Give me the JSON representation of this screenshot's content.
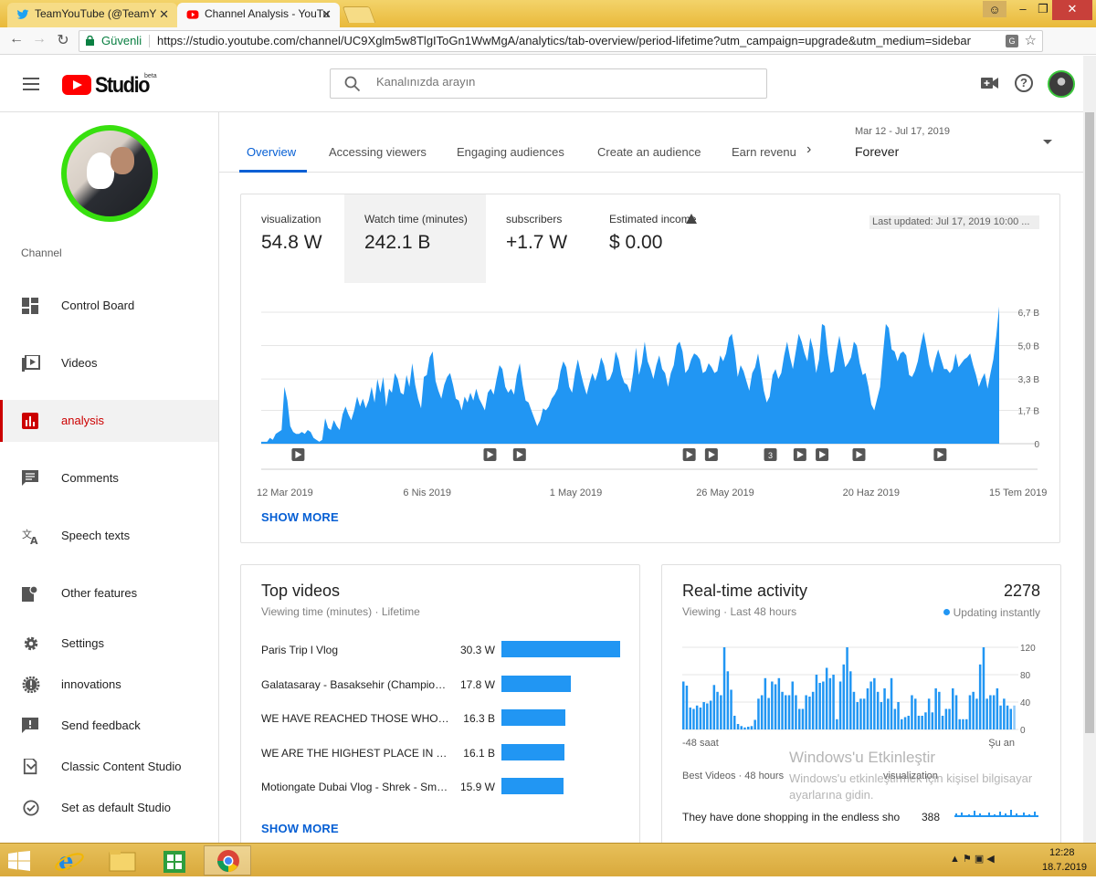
{
  "browser": {
    "tabs": [
      {
        "title": "TeamYouTube (@TeamY",
        "favicon": "twitter-icon"
      },
      {
        "title": "Channel Analysis - YouTu",
        "favicon": "youtube-icon"
      }
    ],
    "close_glyph": "✕",
    "secure_label": "Güvenli",
    "url": "https://studio.youtube.com/channel/UC9Xglm5w8TlgIToGn1WwMgA/analytics/tab-overview/period-lifetime?utm_campaign=upgrade&utm_medium=sidebar",
    "colors": {
      "tabbar": "#f3d36a",
      "close": "#c8403a"
    }
  },
  "header": {
    "logo_text": "Studio",
    "logo_badge": "beta",
    "search_placeholder": "Kanalınızda arayın",
    "brand_color": "#ff0000"
  },
  "sidebar": {
    "channel_label": "Channel",
    "items": [
      {
        "label": "Control Board",
        "icon": "dashboard-icon",
        "active": false
      },
      {
        "label": "Videos",
        "icon": "video-library-icon",
        "active": false
      },
      {
        "label": "analysis",
        "icon": "analytics-icon",
        "active": true
      },
      {
        "label": "Comments",
        "icon": "comment-icon",
        "active": false
      },
      {
        "label": "Speech texts",
        "icon": "translate-icon",
        "active": false
      },
      {
        "label": "Other features",
        "icon": "more-features-icon",
        "active": false
      },
      {
        "label": "Settings",
        "icon": "gear-icon",
        "active": false
      },
      {
        "label": "innovations",
        "icon": "alert-badge-icon",
        "active": false
      },
      {
        "label": "Send feedback",
        "icon": "feedback-icon",
        "active": false
      },
      {
        "label": "Classic Content Studio",
        "icon": "classic-studio-icon",
        "active": false
      },
      {
        "label": "Set as default Studio",
        "icon": "check-circle-icon",
        "active": false
      }
    ],
    "active_color": "#cc0000"
  },
  "analytics": {
    "tabs": [
      "Overview",
      "Accessing viewers",
      "Engaging audiences",
      "Create an audience",
      "Earn revenu"
    ],
    "period_dates": "Mar 12 - Jul 17, 2019",
    "period_value": "Forever",
    "metrics": [
      {
        "label": "visualization",
        "value": "54.8 W"
      },
      {
        "label": "Watch time (minutes)",
        "value": "242.1 B",
        "selected": true
      },
      {
        "label": "subscribers",
        "value": "+1.7 W"
      },
      {
        "label": "Estimated income",
        "value": "$ 0.00",
        "warning": true
      }
    ],
    "last_updated": "Last updated: Jul 17, 2019 10:00 ...",
    "show_more": "SHOW MORE",
    "accent": "#065fd4"
  },
  "chart_data": [
    {
      "type": "area",
      "title": "",
      "ylabel": "",
      "y_ticks": [
        "0",
        "1,7 B",
        "3,3 B",
        "5,0 B",
        "6,7 B"
      ],
      "y_tick_values": [
        0,
        1.7,
        3.3,
        5.0,
        6.7
      ],
      "ylim": [
        0,
        6.7
      ],
      "x_ticks": [
        "12 Mar 2019",
        "6 Nis 2019",
        "1 May 2019",
        "26 May 2019",
        "20 Haz 2019",
        "15 Tem 2019"
      ],
      "series": [
        {
          "values": [
            0.1,
            0.1,
            0.1,
            0.3,
            0.2,
            0.5,
            0.6,
            0.7,
            2.9,
            2.2,
            0.9,
            0.6,
            0.5,
            0.5,
            0.6,
            0.5,
            0.7,
            0.6,
            0.3,
            0.2,
            0.1,
            0.2,
            1.3,
            0.8,
            0.7,
            1.2,
            0.9,
            0.7,
            1.5,
            1.9,
            1.5,
            1.2,
            1.7,
            2.4,
            1.9,
            2.3,
            1.8,
            2.2,
            2.9,
            2.1,
            3.3,
            2.6,
            3.4,
            1.9,
            2.8,
            2.6,
            3.6,
            3.3,
            2.6,
            2.5,
            3.5,
            2.9,
            4.1,
            3.0,
            2.3,
            1.8,
            3.4,
            3.5,
            4.4,
            4.7,
            3.2,
            2.7,
            2.3,
            3.0,
            3.4,
            3.6,
            3.0,
            2.3,
            2.2,
            1.7,
            2.4,
            2.1,
            2.6,
            2.2,
            2.8,
            2.3,
            2.0,
            1.7,
            2.6,
            2.8,
            2.5,
            3.3,
            4.0,
            3.8,
            2.9,
            2.6,
            2.8,
            2.5,
            3.5,
            4.1,
            3.0,
            2.2,
            2.1,
            1.7,
            1.3,
            0.9,
            1.2,
            1.8,
            1.7,
            1.9,
            2.3,
            2.5,
            2.8,
            3.7,
            4.2,
            3.9,
            2.9,
            2.6,
            3.6,
            4.3,
            3.6,
            3.0,
            2.5,
            3.1,
            3.6,
            3.2,
            3.7,
            4.4,
            4.0,
            3.2,
            3.3,
            3.7,
            4.7,
            4.3,
            3.5,
            3.1,
            3.0,
            2.6,
            3.6,
            4.9,
            3.5,
            4.1,
            5.2,
            4.2,
            3.8,
            3.3,
            4.0,
            4.5,
            3.8,
            3.6,
            2.9,
            3.6,
            4.0,
            5.0,
            5.2,
            4.7,
            3.6,
            3.8,
            4.3,
            4.6,
            4.5,
            4.3,
            3.6,
            3.7,
            4.1,
            3.9,
            3.6,
            3.7,
            4.5,
            4.2,
            4.6,
            5.4,
            5.6,
            4.7,
            3.4,
            4.0,
            3.7,
            3.2,
            2.7,
            3.6,
            3.9,
            4.6,
            3.7,
            2.7,
            2.1,
            2.4,
            3.5,
            3.8,
            3.3,
            3.6,
            4.5,
            5.2,
            4.4,
            3.8,
            4.7,
            5.6,
            5.2,
            4.6,
            4.2,
            5.4,
            4.8,
            3.6,
            4.3,
            6.1,
            6.0,
            4.6,
            3.6,
            3.7,
            4.7,
            5.5,
            4.7,
            3.9,
            4.1,
            4.4,
            5.2,
            5.0,
            4.1,
            3.5,
            3.6,
            2.9,
            2.0,
            1.7,
            2.3,
            2.9,
            4.6,
            6.1,
            5.9,
            4.8,
            4.7,
            4.2,
            4.6,
            4.7,
            4.5,
            3.5,
            3.4,
            3.7,
            4.2,
            5.0,
            5.7,
            4.9,
            4.0,
            3.6,
            4.3,
            4.8,
            4.3,
            3.8,
            3.8,
            3.6,
            3.8,
            4.6,
            3.9,
            4.1,
            4.3,
            4.4,
            4.6,
            4.0,
            3.5,
            2.9,
            3.3,
            3.6,
            2.8,
            3.6,
            4.3,
            5.5,
            7.0
          ]
        }
      ],
      "markers": [
        {
          "x_frac": 0.05,
          "label": ""
        },
        {
          "x_frac": 0.31,
          "label": ""
        },
        {
          "x_frac": 0.35,
          "label": ""
        },
        {
          "x_frac": 0.58,
          "label": ""
        },
        {
          "x_frac": 0.61,
          "label": ""
        },
        {
          "x_frac": 0.69,
          "label": "3"
        },
        {
          "x_frac": 0.73,
          "label": ""
        },
        {
          "x_frac": 0.76,
          "label": ""
        },
        {
          "x_frac": 0.81,
          "label": ""
        },
        {
          "x_frac": 0.92,
          "label": ""
        }
      ],
      "color": "#2196f3"
    },
    {
      "type": "bar",
      "title": "",
      "ylabel": "",
      "y_ticks": [
        "0",
        "40",
        "80",
        "120"
      ],
      "y_tick_values": [
        0,
        40,
        80,
        120
      ],
      "ylim": [
        0,
        120
      ],
      "x_ticks": [
        "-48 saat",
        "Şu an"
      ],
      "values": [
        70,
        64,
        32,
        30,
        35,
        32,
        40,
        38,
        42,
        65,
        55,
        50,
        120,
        85,
        58,
        20,
        8,
        5,
        3,
        4,
        5,
        14,
        45,
        50,
        75,
        46,
        70,
        66,
        75,
        55,
        50,
        50,
        70,
        50,
        30,
        30,
        50,
        48,
        55,
        80,
        68,
        70,
        90,
        75,
        80,
        15,
        70,
        95,
        120,
        85,
        55,
        40,
        45,
        45,
        60,
        70,
        75,
        55,
        40,
        60,
        45,
        75,
        30,
        40,
        15,
        18,
        20,
        50,
        45,
        20,
        20,
        25,
        45,
        25,
        60,
        55,
        20,
        30,
        30,
        60,
        50,
        15,
        15,
        15,
        50,
        55,
        45,
        95,
        120,
        45,
        50,
        50,
        60,
        35,
        45,
        35,
        30,
        35
      ],
      "color": "#2196f3"
    }
  ],
  "top_videos": {
    "title": "Top videos",
    "subtitle": "Viewing time (minutes) · Lifetime",
    "rows": [
      {
        "title": "Paris Trip l Vlog",
        "value": "30.3 W",
        "bar": 30.3
      },
      {
        "title": "Galatasaray - Basaksehir (Champion…",
        "value": "17.8 W",
        "bar": 17.8
      },
      {
        "title": "WE HAVE REACHED THOSE WHO W…",
        "value": "16.3 B",
        "bar": 16.3
      },
      {
        "title": "WE ARE THE HIGHEST PLACE IN TH…",
        "value": "16.1 B",
        "bar": 16.1
      },
      {
        "title": "Motiongate Dubai Vlog - Shrek - Sm…",
        "value": "15.9 W",
        "bar": 15.9
      }
    ],
    "bar_max": 30.3,
    "show_more": "SHOW MORE"
  },
  "realtime": {
    "title": "Real-time activity",
    "count": "2278",
    "subtitle": "Viewing · Last 48 hours",
    "updating": "Updating instantly",
    "best_label": "Best Videos · 48 hours",
    "best_metric": "visualization",
    "video_title": "They have done shopping in the endless sho",
    "video_value": "388"
  },
  "watermark": {
    "title": "Windows'u Etkinleştir",
    "body": "Windows'u etkinleştirmek için kişisel bilgisayar ayarlarına gidin."
  },
  "taskbar": {
    "time": "12:28",
    "date": "18.7.2019",
    "tray": "▲  ⚑  ▣  ◀"
  }
}
